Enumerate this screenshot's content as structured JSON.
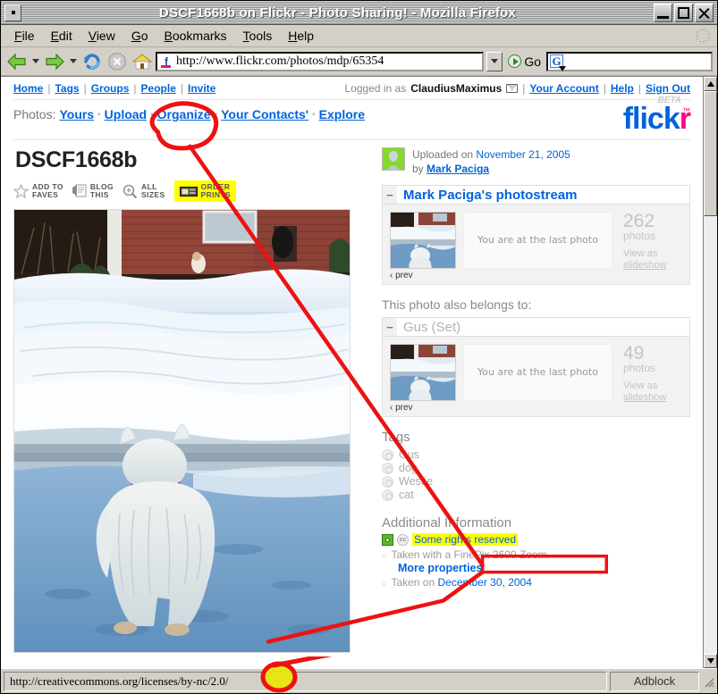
{
  "window": {
    "title": "DSCF1668b on Flickr - Photo Sharing! - Mozilla Firefox",
    "minimize_label": "Minimize",
    "maximize_label": "Maximize",
    "close_label": "Close"
  },
  "menubar": {
    "items": [
      {
        "label": "File",
        "accel": "F"
      },
      {
        "label": "Edit",
        "accel": "E"
      },
      {
        "label": "View",
        "accel": "V"
      },
      {
        "label": "Go",
        "accel": "G"
      },
      {
        "label": "Bookmarks",
        "accel": "B"
      },
      {
        "label": "Tools",
        "accel": "T"
      },
      {
        "label": "Help",
        "accel": "H"
      }
    ]
  },
  "toolbar": {
    "back_icon": "back-arrow-icon",
    "forward_icon": "forward-arrow-icon",
    "reload_icon": "reload-icon",
    "stop_icon": "stop-icon",
    "home_icon": "home-icon",
    "url": "http://www.flickr.com/photos/mdp/65354",
    "go_label": "Go",
    "search_value": "",
    "search_engine": "G"
  },
  "flickr": {
    "topnav": [
      "Home",
      "Tags",
      "Groups",
      "People",
      "Invite"
    ],
    "logged_in_label": "Logged in as",
    "username": "ClaudiusMaximus",
    "account_links": [
      "Your Account",
      "Help",
      "Sign Out"
    ],
    "photos_label": "Photos:",
    "photos_nav": [
      "Yours",
      "Upload",
      "Organize",
      "Your Contacts'",
      "Explore"
    ],
    "logo_blue": "flick",
    "logo_pink": "r",
    "logo_beta": "BETA",
    "logo_tm": "™"
  },
  "photo": {
    "title": "DSCF1668b",
    "actions": [
      {
        "label_line1": "ADD TO",
        "label_line2": "FAVES",
        "icon": "star-icon",
        "highlighted": false
      },
      {
        "label_line1": "BLOG",
        "label_line2": "THIS",
        "icon": "blog-icon",
        "highlighted": false
      },
      {
        "label_line1": "ALL",
        "label_line2": "SIZES",
        "icon": "magnifier-icon",
        "highlighted": false
      },
      {
        "label_line1": "ORDER",
        "label_line2": "PRINTS",
        "icon": "order-prints-icon",
        "highlighted": true
      }
    ],
    "alt": "A white Westie dog seen from behind standing on a snowy driveway in front of a brick house"
  },
  "uploaded": {
    "prefix": "Uploaded on",
    "date": "November 21, 2005",
    "by_label": "by",
    "author": "Mark Paciga"
  },
  "photostream": {
    "title": "Mark Paciga's photostream",
    "collapse_glyph": "−",
    "at_last_photo": "You are at the last photo",
    "count": "262",
    "count_label": "photos",
    "view_as": "View as",
    "slideshow": "slideshow",
    "prev": "‹ prev"
  },
  "belongs": {
    "heading": "This photo also belongs to:",
    "set_title": "Gus (Set)",
    "collapse_glyph": "−",
    "at_last_photo": "You are at the last photo",
    "count": "49",
    "count_label": "photos",
    "view_as": "View as",
    "slideshow": "slideshow",
    "prev": "‹ prev"
  },
  "tags": {
    "heading": "Tags",
    "items": [
      "Gus",
      "dog",
      "Westie",
      "cat"
    ]
  },
  "additional": {
    "heading": "Additional Information",
    "license_text": "Some rights reserved",
    "license_icon_1": "cc-circle-icon",
    "license_icon_2": "creative-commons-icon",
    "camera_prefix": "Taken with a",
    "camera": "FinePix 2600 Zoom.",
    "more_properties": "More properties",
    "taken_prefix": "Taken on",
    "taken_date": "December 30, 2004"
  },
  "statusbar": {
    "url": "http://creativecommons.org/licenses/by-nc/2.0/",
    "adblock": "Adblock"
  },
  "annotations": {
    "highlight_color": "#ffff00",
    "marker_color": "#ee1111",
    "circled_order_prints": true,
    "circled_nc_in_url": true,
    "boxed_license_link": true
  }
}
